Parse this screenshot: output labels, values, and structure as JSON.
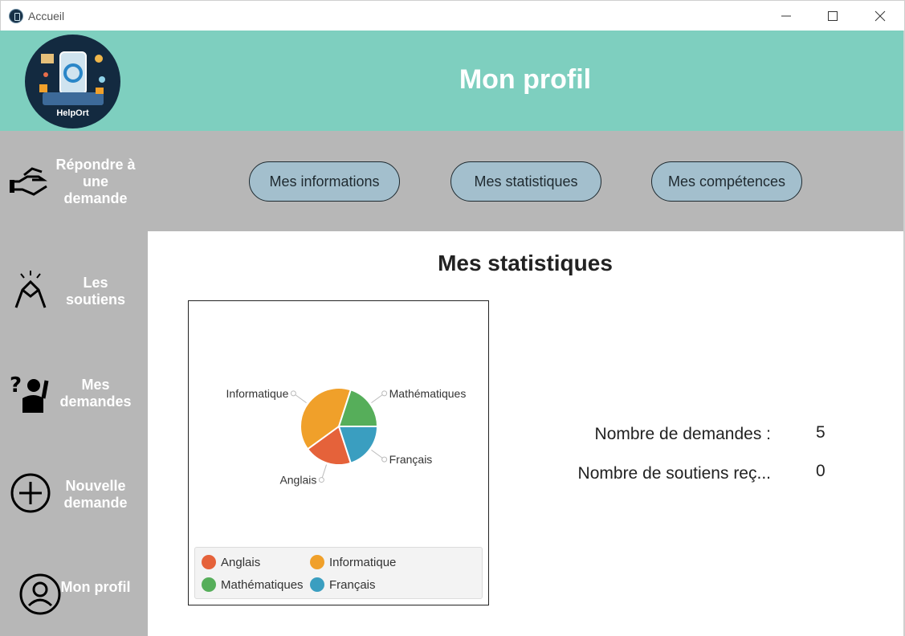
{
  "window": {
    "title": "Accueil"
  },
  "header": {
    "title": "Mon profil",
    "logo_text": "HelpOrt"
  },
  "sidebar": {
    "items": [
      {
        "label": "Répondre à une demande",
        "icon": "handshake-offer-icon"
      },
      {
        "label": "Les soutiens",
        "icon": "clasped-hands-icon"
      },
      {
        "label": "Mes demandes",
        "icon": "question-person-icon"
      },
      {
        "label": "Nouvelle demande",
        "icon": "plus-circle-icon"
      },
      {
        "label": "Mon profil",
        "icon": "user-circle-icon"
      }
    ]
  },
  "tabs": [
    {
      "label": "Mes informations"
    },
    {
      "label": "Mes statistiques"
    },
    {
      "label": "Mes compétences"
    }
  ],
  "main": {
    "title": "Mes statistiques",
    "stats": [
      {
        "label": "Nombre de demandes :",
        "value": "5"
      },
      {
        "label": "Nombre de soutiens reç...",
        "value": "0"
      }
    ]
  },
  "chart_data": {
    "type": "pie",
    "title": "",
    "slices": [
      {
        "name": "Anglais",
        "value": 20,
        "color": "#e5623a"
      },
      {
        "name": "Informatique",
        "value": 40,
        "color": "#f0a02a"
      },
      {
        "name": "Mathématiques",
        "value": 20,
        "color": "#56ae5a"
      },
      {
        "name": "Français",
        "value": 20,
        "color": "#3a9ec0"
      }
    ],
    "legend": "bottom"
  },
  "colors": {
    "header_bg": "#7ecfbf",
    "sidebar_bg": "#b7b7b7",
    "tab_bg": "#a3bfcd"
  }
}
